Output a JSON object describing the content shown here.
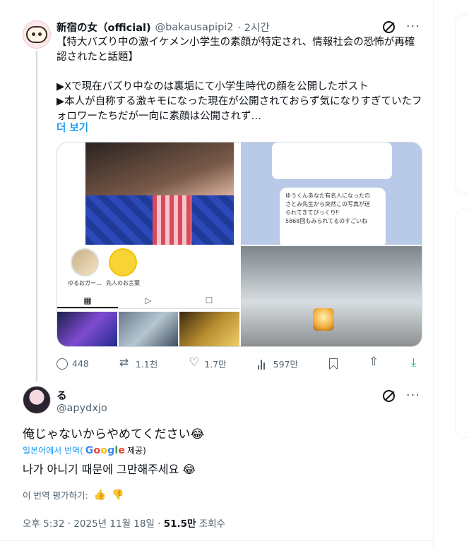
{
  "parent_tweet": {
    "display_name": "新宿の女（official)",
    "handle": "@bakausapipi2",
    "time": "· 2시간",
    "text": "【特大バズり中の激イケメン小学生の素顔が特定され、情報社会の恐怖が再確認されたと話題】\n\n▶Xで現在バズり中なのは裏垢にて小学生時代の顔を公開したポスト\n▶本人が自称する激キモになった現在が公開されておらず気になりすぎていたフォロワーたちだが一向に素顔は公開されず…",
    "show_more": "더 보기",
    "media": {
      "highlight_1": "ゆるおガー…",
      "highlight_2": "先人のお言葉",
      "chat_text": "ゆうくんあなた有名人になったの\nさとみ先生から突然この写真が送\nられてきてびっくり‼\n5868回もみられてるのすごいね"
    },
    "stats": {
      "replies": "448",
      "reposts": "1.1천",
      "likes": "1.7만",
      "views": "597만"
    }
  },
  "main_tweet": {
    "display_name": "る",
    "handle": "@apydxjo",
    "text": "俺じゃないからやめてください😂",
    "translate_prefix": "일본어에서 번역(",
    "translate_suffix": " 제공)",
    "google": "Google",
    "translated_text": "나가 아니기 때문에 그만해주세요 😂",
    "rate_label": "이 번역 평가하기:",
    "timestamp": "오후 5:32 · 2025년 11월 18일 · ",
    "views_count": "51.5만",
    "views_label": " 조회수"
  },
  "icons": [
    "grok-icon",
    "more-icon",
    "reply-icon",
    "repost-icon",
    "like-icon",
    "views-icon",
    "bookmark-icon",
    "share-icon",
    "download-icon",
    "thumbs-up-icon",
    "thumbs-down-icon"
  ],
  "colors": {
    "accent": "#1d9bf0",
    "muted": "#536471",
    "download": "#00ba7c"
  }
}
